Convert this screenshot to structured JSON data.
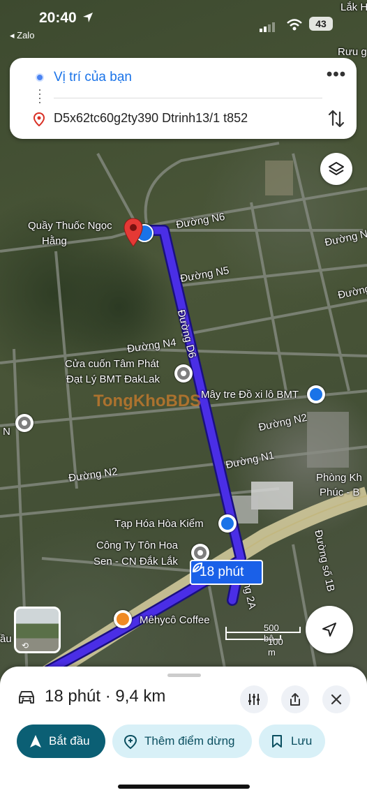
{
  "status_bar": {
    "time": "20:40",
    "back_app": "◂ Zalo",
    "battery": "43"
  },
  "directions": {
    "from": "Vị trí của bạn",
    "to": "D5x62tc60g2ty390 Dtrinh13/1 t852"
  },
  "map": {
    "place_labels": [
      "Lắk H",
      "Rưu g",
      "Quầy Thuốc Ngọc",
      "Hằng",
      "Đường N6",
      "Đường N",
      "Đường N5",
      "Đường",
      "Đường D6",
      "Đường N4",
      "Cửa cuốn Tâm Phát",
      "Đạt Lý BMT ĐakLak",
      "Mây tre Đồ xi lô BMT",
      "Đường N2",
      "Đường N1",
      "Đường N2",
      "Phòng Kh",
      "Phúc - B",
      "Tạp Hóa Hòa Kiểm",
      "Công Ty Tôn Hoa",
      "Sen - CN Đắk Lắk",
      "Đường số 1B",
      "ờng 2A",
      "Mêhycô Coffee",
      "ầu",
      "N"
    ],
    "watermark": "TongKhoBDS",
    "eta_chip": "18 phút",
    "scale_imperial": "500 bộ",
    "scale_metric": "100 m",
    "route_color": "#4a2ee6"
  },
  "sheet": {
    "summary": "18 phút · 9,4 km",
    "start_label": "Bắt đầu",
    "add_stop_label": "Thêm điểm dừng",
    "save_label": "Lưu"
  },
  "icons": [
    "back-arrow",
    "location-arrow",
    "cell-signal",
    "wifi",
    "battery",
    "more-dots",
    "pin",
    "swap",
    "layers",
    "pharmacy-pin",
    "poi-pin",
    "lock-pin",
    "coffee-pin",
    "leaf",
    "street-view",
    "navigate",
    "car",
    "filter-sliders",
    "share",
    "close",
    "navigation-arrow",
    "add-pin",
    "bookmark"
  ]
}
